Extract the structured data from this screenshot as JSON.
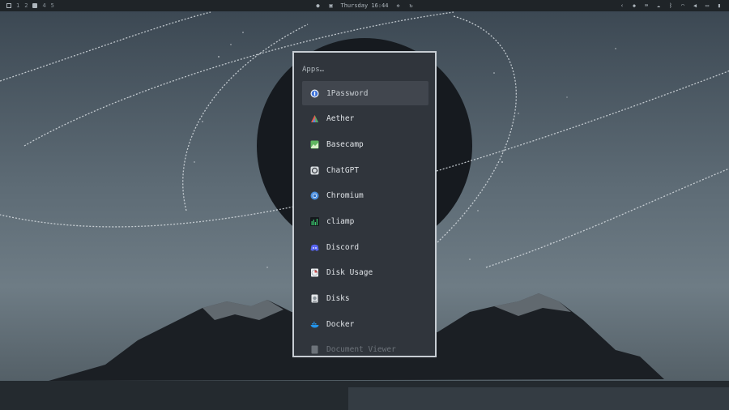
{
  "topbar": {
    "workspaces": [
      "1",
      "2",
      "4",
      "5"
    ],
    "clock": "Thursday 16:44",
    "icons_left": [
      "window-icon",
      "stop-square-icon"
    ],
    "icons_center": [
      "record-icon",
      "screen-share-icon",
      "brightness-icon",
      "refresh-icon"
    ],
    "icons_right": [
      "chevron-left-icon",
      "dropbox-icon",
      "keyboard-icon",
      "cloud-icon",
      "bluetooth-icon",
      "wifi-icon",
      "volume-icon",
      "display-icon",
      "battery-icon"
    ]
  },
  "launcher": {
    "placeholder": "Apps…",
    "items": [
      {
        "label": "1Password",
        "icon": "onepassword-icon",
        "color": "#3a6fd8",
        "selected": true
      },
      {
        "label": "Aether",
        "icon": "aether-icon",
        "color": "#e8594a"
      },
      {
        "label": "Basecamp",
        "icon": "basecamp-icon",
        "color": "#5fb760"
      },
      {
        "label": "ChatGPT",
        "icon": "chatgpt-icon",
        "color": "#d9dde0"
      },
      {
        "label": "Chromium",
        "icon": "chromium-icon",
        "color": "#4a8fe0"
      },
      {
        "label": "cliamp",
        "icon": "cliamp-icon",
        "color": "#39c06a"
      },
      {
        "label": "Discord",
        "icon": "discord-icon",
        "color": "#5865f2"
      },
      {
        "label": "Disk Usage",
        "icon": "disk-usage-icon",
        "color": "#c94a4a"
      },
      {
        "label": "Disks",
        "icon": "disks-icon",
        "color": "#c9ced3"
      },
      {
        "label": "Docker",
        "icon": "docker-icon",
        "color": "#2496ed"
      },
      {
        "label": "Document Viewer",
        "icon": "document-viewer-icon",
        "color": "#8d949b",
        "faded": true
      }
    ]
  }
}
